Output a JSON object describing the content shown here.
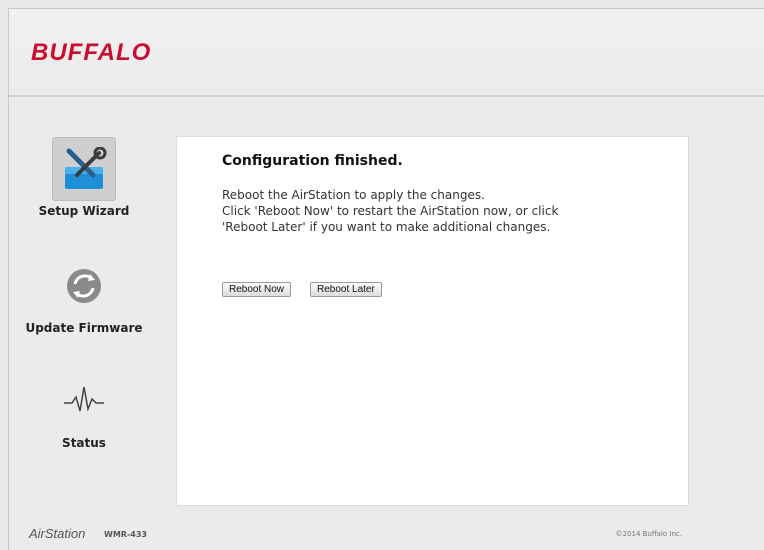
{
  "header": {
    "logo_text": "BUFFALO",
    "logo_color": "#c8102e"
  },
  "sidebar": {
    "items": [
      {
        "label": "Setup Wizard",
        "icon": "toolbox-icon",
        "active": true
      },
      {
        "label": "Update Firmware",
        "icon": "refresh-icon",
        "active": false
      },
      {
        "label": "Status",
        "icon": "pulse-icon",
        "active": false
      }
    ]
  },
  "main": {
    "title": "Configuration finished.",
    "message_lines": [
      "Reboot the AirStation to apply the changes.",
      "Click 'Reboot Now' to restart the AirStation now, or click",
      "'Reboot Later' if you want to make additional changes."
    ],
    "buttons": {
      "reboot_now": "Reboot Now",
      "reboot_later": "Reboot Later"
    }
  },
  "footer": {
    "brand": "AirStation",
    "model": "WMR-433",
    "copyright": "©2014 Buffalo Inc."
  }
}
